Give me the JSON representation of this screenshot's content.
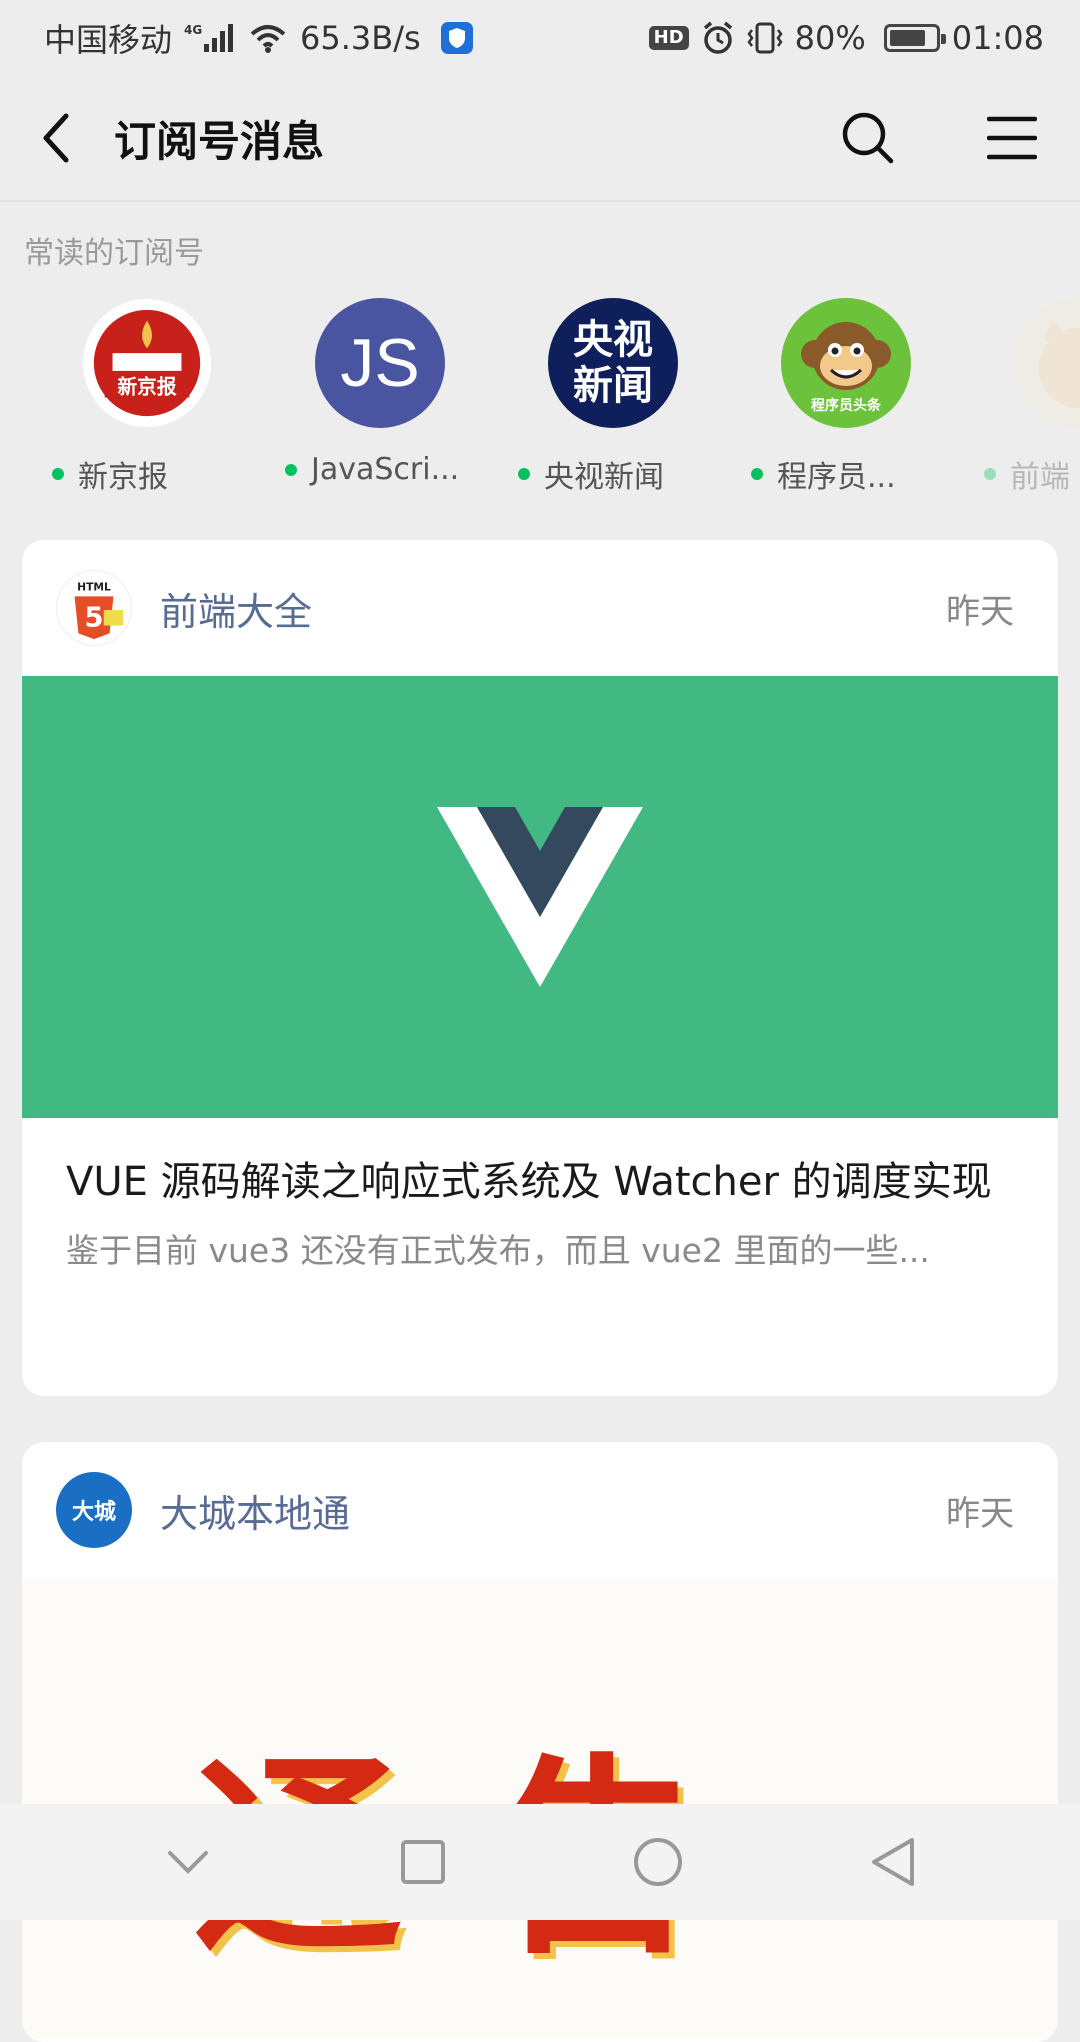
{
  "status_bar": {
    "carrier": "中国移动",
    "network": "4G",
    "speed": "65.3B/s",
    "hd": "HD",
    "battery_text": "80%",
    "battery_level": 0.8,
    "time": "01:08"
  },
  "nav": {
    "title": "订阅号消息"
  },
  "frequent": {
    "label": "常读的订阅号",
    "items": [
      {
        "name": "新京报",
        "avatar_text": "新京报",
        "color": "#c8201b"
      },
      {
        "name": "JavaScri...",
        "avatar_text": "JS",
        "color": "#4a55a2"
      },
      {
        "name": "央视新闻",
        "avatar_text": "央视新闻",
        "color": "#0f1f5c"
      },
      {
        "name": "程序员...",
        "avatar_text": "程序员头条",
        "color": "#6cc23a"
      },
      {
        "name": "前端"
      }
    ]
  },
  "cards": [
    {
      "account": "前端大全",
      "account_badge": "HTML",
      "time": "昨天",
      "cover_color": "#42b983",
      "title": "VUE 源码解读之响应式系统及 Watcher 的调度实现",
      "summary": "鉴于目前 vue3 还没有正式发布，而且 vue2 里面的一些..."
    },
    {
      "account": "大城本地通",
      "account_badge": "大城",
      "time": "昨天",
      "cover_text": "通告"
    }
  ]
}
